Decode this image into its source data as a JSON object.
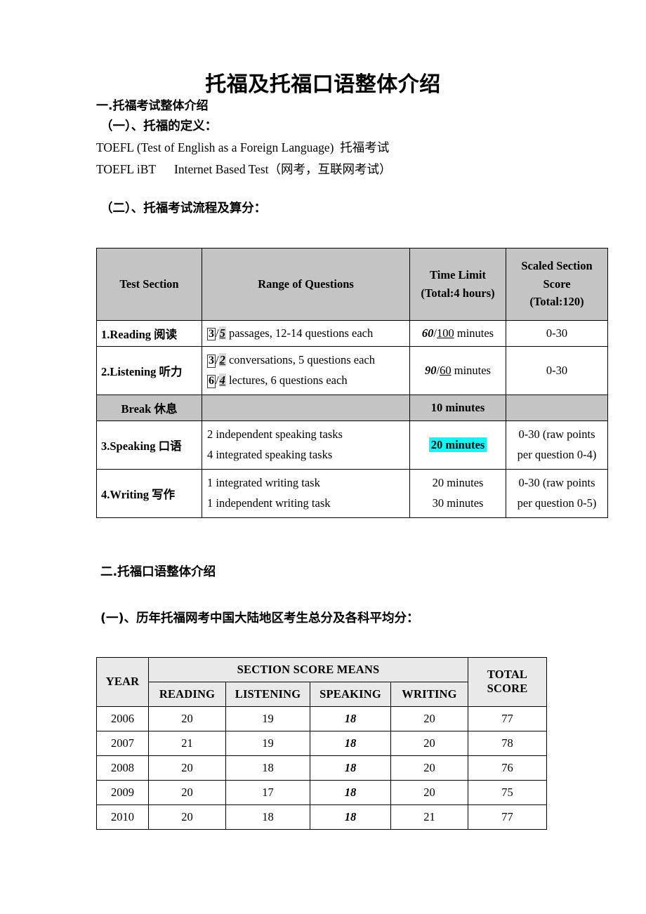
{
  "document": {
    "title": "托福及托福口语整体介绍",
    "section_one_heading": "一.托福考试整体介绍",
    "subsection_one_heading": "（一）、托福的定义：",
    "definition_line_1": "TOEFL (Test of English as a Foreign Language)  托福考试",
    "definition_line_2": "TOEFL iBT      Internet Based Test（网考，互联网考试）",
    "subsection_two_heading": "（二）、托福考试流程及算分：",
    "section_two_heading": "二.托福口语整体介绍",
    "subsection_three_heading": "(一)、历年托福网考中国大陆地区考生总分及各科平均分："
  },
  "exam_flow_table": {
    "headers": {
      "test_section": "Test Section",
      "range_of_questions": "Range of Questions",
      "time_limit_line1": "Time Limit",
      "time_limit_line2": "(Total:4 hours)",
      "scaled_score_line1": "Scaled Section",
      "scaled_score_line2": "Score",
      "scaled_score_line3": "(Total:120)"
    },
    "rows": [
      {
        "section": "1.Reading 阅读",
        "q_old": "3",
        "q_new": "5",
        "q_text": " passages, 12-14 questions each",
        "time_old": "60",
        "time_new": "100",
        "time_unit": " minutes",
        "score": "0-30"
      },
      {
        "section": "2.Listening 听力",
        "q_old": "3",
        "q_new": "2",
        "q_text": " conversations, 5 questions each",
        "q2_old": "6",
        "q2_new": "4",
        "q2_text": " lectures, 6 questions each",
        "time_old": "90",
        "time_new": "60",
        "time_unit": " minutes",
        "score": "0-30"
      }
    ],
    "break_row": {
      "label": "Break 休息",
      "time": "10 minutes"
    },
    "speaking_row": {
      "section": "3.Speaking 口语",
      "task_line1": "2 independent speaking tasks",
      "task_line2": "4 integrated speaking tasks",
      "time_highlighted": "20 minutes",
      "score_line1": "0-30 (raw points",
      "score_line2": "per question 0-4)"
    },
    "writing_row": {
      "section": "4.Writing 写作",
      "task_line1": "1 integrated writing task",
      "task_line2": "1 independent writing task",
      "time_line1": "20 minutes",
      "time_line2": "30 minutes",
      "score_line1": "0-30 (raw points",
      "score_line2": "per question 0-5)"
    },
    "highlight_color": "#00ffff",
    "header_fill": "#c4c4c4"
  },
  "score_table": {
    "header_fill": "#e9e9e9",
    "headers": {
      "year": "YEAR",
      "group": "SECTION SCORE MEANS",
      "reading": "READING",
      "listening": "LISTENING",
      "speaking": "SPEAKING",
      "writing": "WRITING",
      "total_line1": "TOTAL",
      "total_line2": "SCORE"
    },
    "rows": [
      {
        "year": "2006",
        "reading": "20",
        "listening": "19",
        "speaking": "18",
        "writing": "20",
        "total": "77"
      },
      {
        "year": "2007",
        "reading": "21",
        "listening": "19",
        "speaking": "18",
        "writing": "20",
        "total": "78"
      },
      {
        "year": "2008",
        "reading": "20",
        "listening": "18",
        "speaking": "18",
        "writing": "20",
        "total": "76"
      },
      {
        "year": "2009",
        "reading": "20",
        "listening": "17",
        "speaking": "18",
        "writing": "20",
        "total": "75"
      },
      {
        "year": "2010",
        "reading": "20",
        "listening": "18",
        "speaking": "18",
        "writing": "21",
        "total": "77"
      }
    ]
  },
  "chart_data": {
    "type": "table",
    "title": "历年托福网考中国大陆地区考生总分及各科平均分",
    "categories": [
      "2006",
      "2007",
      "2008",
      "2009",
      "2010"
    ],
    "xlabel": "YEAR",
    "ylabel": "SECTION SCORE MEANS",
    "series": [
      {
        "name": "READING",
        "values": [
          20,
          21,
          20,
          20,
          20
        ]
      },
      {
        "name": "LISTENING",
        "values": [
          19,
          19,
          18,
          17,
          18
        ]
      },
      {
        "name": "SPEAKING",
        "values": [
          18,
          18,
          18,
          18,
          18
        ]
      },
      {
        "name": "WRITING",
        "values": [
          20,
          20,
          20,
          20,
          21
        ]
      },
      {
        "name": "TOTAL SCORE",
        "values": [
          77,
          78,
          76,
          75,
          77
        ]
      }
    ]
  }
}
